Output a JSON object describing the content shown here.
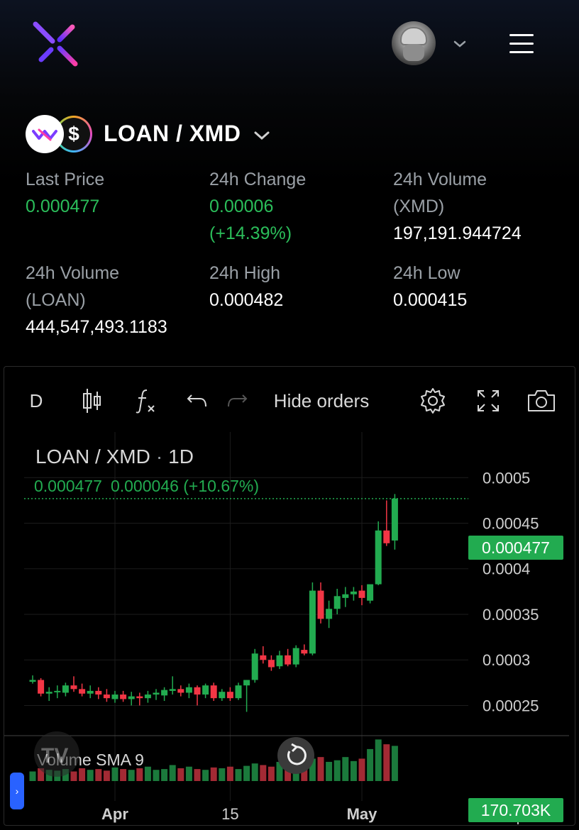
{
  "header": {
    "brand": "XMD",
    "menu_label": "Menu"
  },
  "pair": {
    "title": "LOAN / XMD",
    "quote_symbol": "$"
  },
  "stats": {
    "last_price_label": "Last Price",
    "last_price": "0.000477",
    "change_label": "24h Change",
    "change_value": "0.00006",
    "change_pct": "(+14.39%)",
    "vol_xmd_label_1": "24h Volume",
    "vol_xmd_label_2": "(XMD)",
    "vol_xmd": "197,191.944724",
    "vol_loan_label_1": "24h Volume",
    "vol_loan_label_2": "(LOAN)",
    "vol_loan": "444,547,493.1183",
    "high_label": "24h High",
    "high": "0.000482",
    "low_label": "24h Low",
    "low": "0.000415"
  },
  "toolbar": {
    "interval": "D",
    "hide_orders": "Hide orders",
    "icons": [
      "candles-icon",
      "indicators-icon",
      "undo-icon",
      "redo-icon",
      "settings-icon",
      "fullscreen-icon",
      "camera-icon"
    ]
  },
  "chart_header": {
    "symbol": "LOAN / XMD",
    "separator": "·",
    "interval": "1D",
    "price": "0.000477",
    "change": "0.000046 (+10.67%)",
    "volume_label": "Volume SMA 9"
  },
  "badges": {
    "last_price": "0.000477",
    "volume": "170.703K"
  },
  "colors": {
    "up": "#22ab50",
    "down": "#f23645",
    "accent": "#2962ff"
  },
  "chart_data": {
    "type": "candlestick",
    "interval": "1D",
    "y_ticks": [
      0.0005,
      0.00045,
      0.0004,
      0.00035,
      0.0003,
      0.00025
    ],
    "y_tick_labels": [
      "0.0005",
      "0.00045",
      "0.0004",
      "0.00035",
      "0.0003",
      "0.00025"
    ],
    "ylim": [
      0.00022,
      0.000522
    ],
    "x_tick_labels": [
      {
        "label": "Apr",
        "index": 10,
        "bold": true
      },
      {
        "label": "15",
        "index": 24,
        "bold": false
      },
      {
        "label": "May",
        "index": 40,
        "bold": true
      }
    ],
    "candles": [
      {
        "o": 0.000276,
        "h": 0.000283,
        "l": 0.000274,
        "c": 0.000278
      },
      {
        "o": 0.000278,
        "h": 0.00028,
        "l": 0.00026,
        "c": 0.000263
      },
      {
        "o": 0.000263,
        "h": 0.00027,
        "l": 0.000255,
        "c": 0.000265
      },
      {
        "o": 0.000265,
        "h": 0.000272,
        "l": 0.000258,
        "c": 0.000266
      },
      {
        "o": 0.000264,
        "h": 0.000275,
        "l": 0.00026,
        "c": 0.000272
      },
      {
        "o": 0.000272,
        "h": 0.000282,
        "l": 0.000265,
        "c": 0.000268
      },
      {
        "o": 0.000268,
        "h": 0.000274,
        "l": 0.00026,
        "c": 0.000263
      },
      {
        "o": 0.000263,
        "h": 0.000272,
        "l": 0.000258,
        "c": 0.000266
      },
      {
        "o": 0.000266,
        "h": 0.00027,
        "l": 0.000257,
        "c": 0.000262
      },
      {
        "o": 0.000262,
        "h": 0.000268,
        "l": 0.000254,
        "c": 0.000258
      },
      {
        "o": 0.000257,
        "h": 0.000266,
        "l": 0.000253,
        "c": 0.000262
      },
      {
        "o": 0.000262,
        "h": 0.000266,
        "l": 0.000254,
        "c": 0.000257
      },
      {
        "o": 0.000257,
        "h": 0.000265,
        "l": 0.00025,
        "c": 0.00026
      },
      {
        "o": 0.00026,
        "h": 0.000264,
        "l": 0.00025,
        "c": 0.000258
      },
      {
        "o": 0.000258,
        "h": 0.000266,
        "l": 0.000253,
        "c": 0.000262
      },
      {
        "o": 0.000262,
        "h": 0.000268,
        "l": 0.000256,
        "c": 0.000264
      },
      {
        "o": 0.000261,
        "h": 0.00027,
        "l": 0.000255,
        "c": 0.000267
      },
      {
        "o": 0.000266,
        "h": 0.000282,
        "l": 0.000262,
        "c": 0.000268
      },
      {
        "o": 0.000268,
        "h": 0.000272,
        "l": 0.00026,
        "c": 0.000264
      },
      {
        "o": 0.000264,
        "h": 0.000274,
        "l": 0.000258,
        "c": 0.00027
      },
      {
        "o": 0.00027,
        "h": 0.000272,
        "l": 0.00025,
        "c": 0.000262
      },
      {
        "o": 0.000262,
        "h": 0.000274,
        "l": 0.000258,
        "c": 0.000272
      },
      {
        "o": 0.000272,
        "h": 0.000275,
        "l": 0.000255,
        "c": 0.000258
      },
      {
        "o": 0.000258,
        "h": 0.000268,
        "l": 0.000255,
        "c": 0.000265
      },
      {
        "o": 0.000265,
        "h": 0.00027,
        "l": 0.000255,
        "c": 0.000258
      },
      {
        "o": 0.000258,
        "h": 0.000275,
        "l": 0.000256,
        "c": 0.000272
      },
      {
        "o": 0.000272,
        "h": 0.000278,
        "l": 0.000243,
        "c": 0.000278
      },
      {
        "o": 0.000278,
        "h": 0.000312,
        "l": 0.000275,
        "c": 0.000307
      },
      {
        "o": 0.000305,
        "h": 0.000315,
        "l": 0.000296,
        "c": 0.0003
      },
      {
        "o": 0.0003,
        "h": 0.000305,
        "l": 0.000288,
        "c": 0.000292
      },
      {
        "o": 0.000293,
        "h": 0.00031,
        "l": 0.00029,
        "c": 0.000305
      },
      {
        "o": 0.000305,
        "h": 0.000312,
        "l": 0.000293,
        "c": 0.000295
      },
      {
        "o": 0.000295,
        "h": 0.000316,
        "l": 0.000292,
        "c": 0.000313
      },
      {
        "o": 0.000311,
        "h": 0.000317,
        "l": 0.000305,
        "c": 0.000307
      },
      {
        "o": 0.000307,
        "h": 0.000385,
        "l": 0.000305,
        "c": 0.000376
      },
      {
        "o": 0.000376,
        "h": 0.000385,
        "l": 0.00034,
        "c": 0.000345
      },
      {
        "o": 0.000345,
        "h": 0.000365,
        "l": 0.000335,
        "c": 0.000356
      },
      {
        "o": 0.000356,
        "h": 0.000378,
        "l": 0.00035,
        "c": 0.00037
      },
      {
        "o": 0.000368,
        "h": 0.00038,
        "l": 0.000358,
        "c": 0.000372
      },
      {
        "o": 0.000372,
        "h": 0.00038,
        "l": 0.000365,
        "c": 0.000375
      },
      {
        "o": 0.000376,
        "h": 0.000382,
        "l": 0.00036,
        "c": 0.000368
      },
      {
        "o": 0.000365,
        "h": 0.000382,
        "l": 0.000362,
        "c": 0.000383
      },
      {
        "o": 0.000383,
        "h": 0.000452,
        "l": 0.000382,
        "c": 0.000442
      },
      {
        "o": 0.000442,
        "h": 0.000475,
        "l": 0.000425,
        "c": 0.000428
      },
      {
        "o": 0.000431,
        "h": 0.000482,
        "l": 0.000421,
        "c": 0.000477
      }
    ],
    "volumes": [
      12,
      16,
      14,
      13,
      15,
      12,
      16,
      14,
      15,
      13,
      17,
      15,
      14,
      16,
      18,
      14,
      15,
      20,
      16,
      18,
      15,
      14,
      17,
      16,
      18,
      15,
      19,
      22,
      20,
      18,
      24,
      20,
      23,
      26,
      28,
      30,
      24,
      26,
      30,
      25,
      28,
      40,
      52,
      46,
      44
    ],
    "volume_ylim": [
      0,
      55
    ]
  }
}
